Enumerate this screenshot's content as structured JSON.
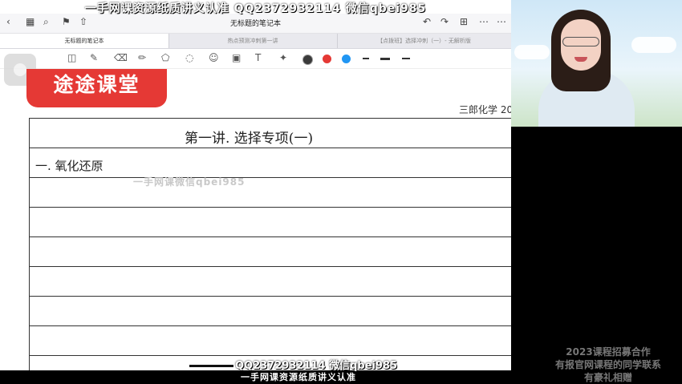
{
  "watermark": {
    "top": "一手网课资源纸质讲义认准 QQ2372932114 微信qbei985",
    "bottom_line1": "QQ2372932114 微信qbei985",
    "bottom_line2": "一手网课资源纸质讲义认准",
    "mid_faint": "一手网课微信qbei985"
  },
  "app": {
    "doc_title": "无标题的笔记本",
    "tabs": [
      {
        "label": "无标题的笔记本",
        "active": true
      },
      {
        "label": "热点预测冲刺第一讲",
        "active": false
      },
      {
        "label": "【点拨班】选择冲刺（一）- 无解析版",
        "active": false
      }
    ],
    "pen_colors": [
      "#3a3a3a",
      "#e53935",
      "#2196f3"
    ]
  },
  "page": {
    "logo_text": "途途课堂",
    "brand_text": "三郎化学 20",
    "heading": "第一讲. 选择专项(一)",
    "note_line1": "一. 氧化还原"
  },
  "promo": {
    "line1": "2023课程招募合作",
    "line2": "有报官网课程的同学联系",
    "line3": "有豪礼相赠"
  }
}
